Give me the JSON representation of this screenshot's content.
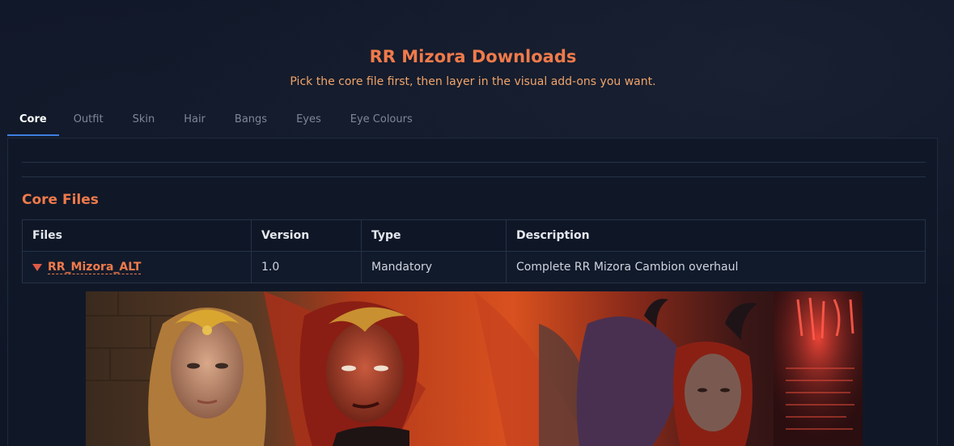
{
  "header": {
    "title": "RR Mizora Downloads",
    "subtitle": "Pick the core file first, then layer in the visual add-ons you want."
  },
  "tabs": [
    {
      "label": "Core",
      "active": true
    },
    {
      "label": "Outfit",
      "active": false
    },
    {
      "label": "Skin",
      "active": false
    },
    {
      "label": "Hair",
      "active": false
    },
    {
      "label": "Bangs",
      "active": false
    },
    {
      "label": "Eyes",
      "active": false
    },
    {
      "label": "Eye Colours",
      "active": false
    }
  ],
  "section": {
    "title": "Core Files"
  },
  "table": {
    "columns": [
      "Files",
      "Version",
      "Type",
      "Description"
    ],
    "rows": [
      {
        "file": "RR_Mizora_ALT",
        "version": "1.0",
        "type": "Mandatory",
        "description": "Complete RR Mizora Cambion overhaul"
      }
    ]
  },
  "colors": {
    "accent": "#f07a4a",
    "tab_underline": "#3f7fe0",
    "background": "#0f1626"
  }
}
